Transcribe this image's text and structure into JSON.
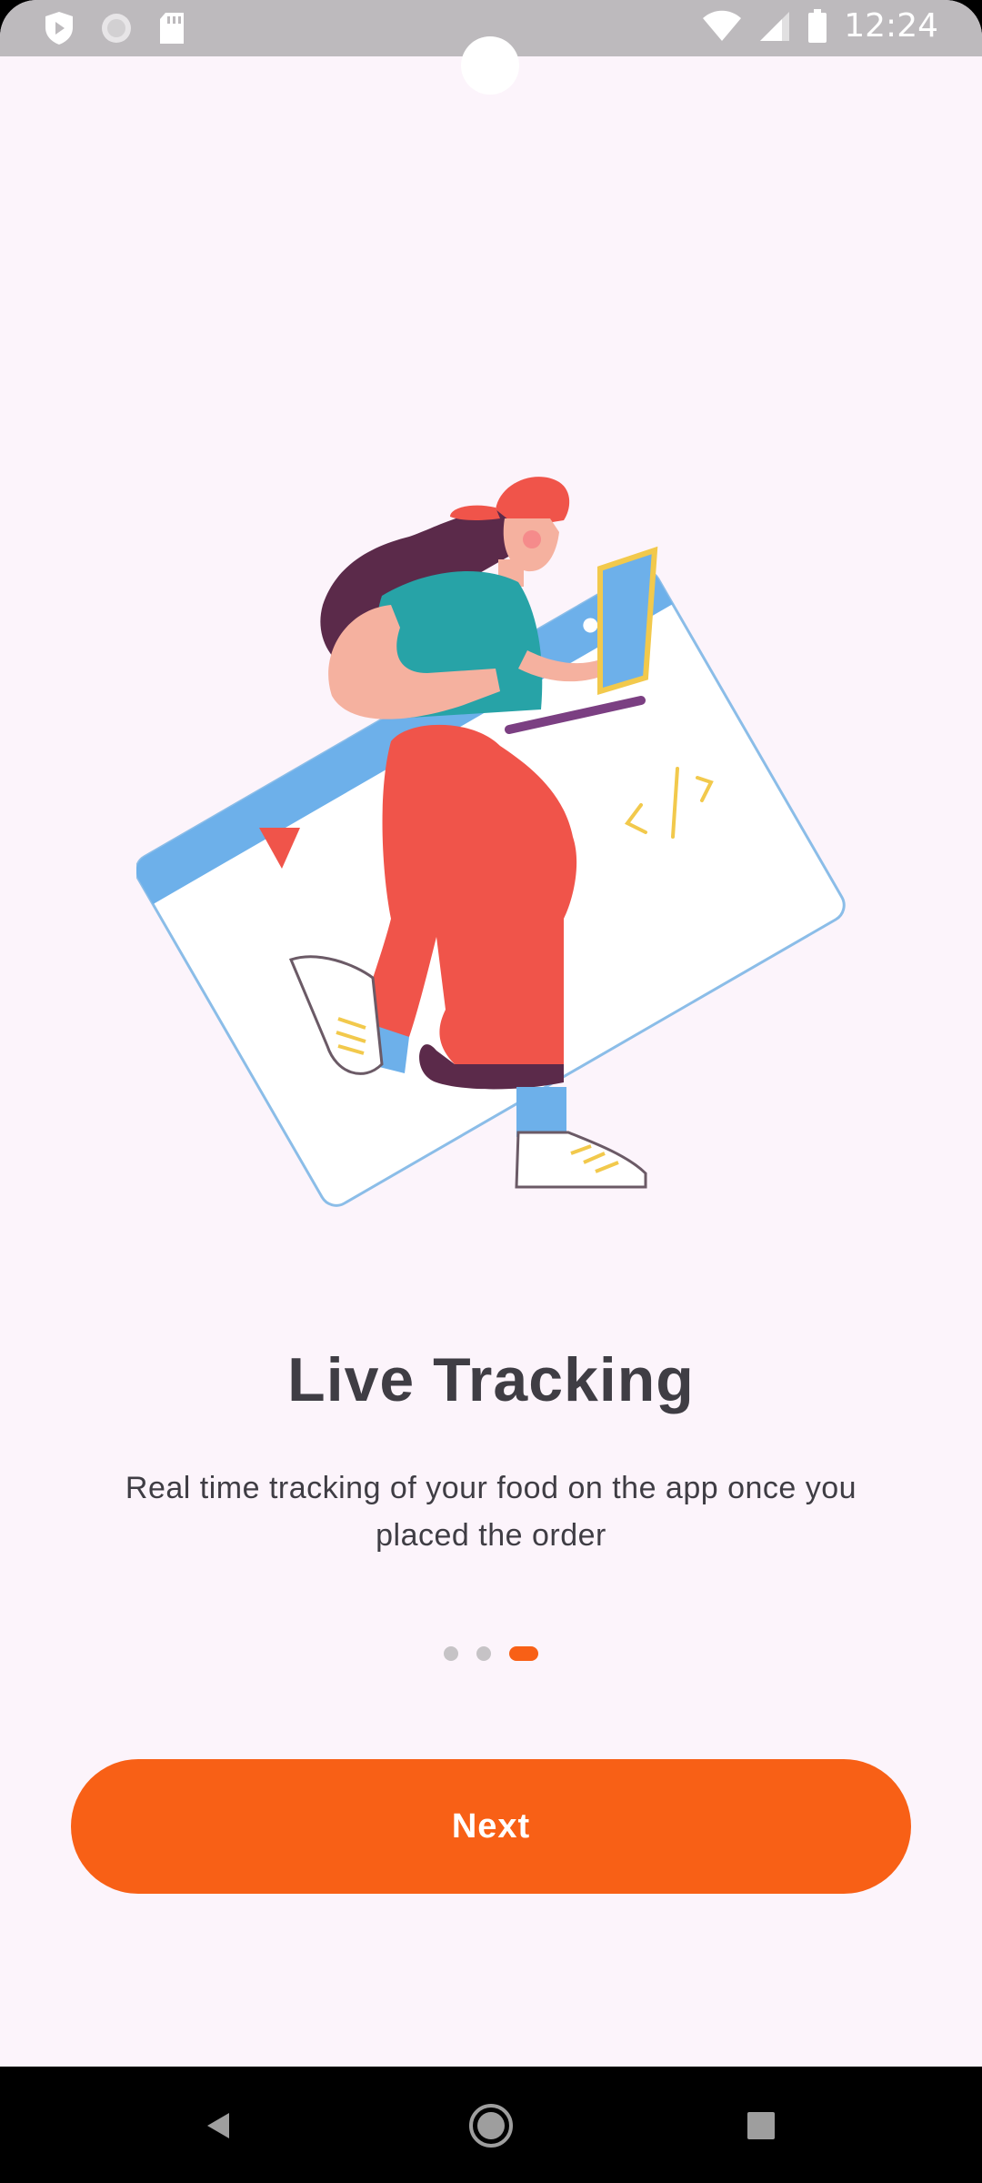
{
  "status_bar": {
    "time": "12:24",
    "icons": [
      "shield-play-icon",
      "circle-status-icon",
      "sd-card-icon",
      "wifi-icon",
      "signal-icon",
      "battery-icon"
    ]
  },
  "illustration": {
    "description_icon": "person-with-laptop-illustration"
  },
  "onboarding": {
    "title": "Live Tracking",
    "subtitle": "Real time tracking of your food on the app once you placed the order",
    "page_count": 3,
    "active_page": 3
  },
  "actions": {
    "next_label": "Next"
  },
  "nav_bar": {
    "icons": [
      "back-icon",
      "home-icon",
      "recents-icon"
    ]
  },
  "colors": {
    "accent": "#f86016",
    "background": "#fcf4fb",
    "text": "#3f3d44",
    "status_bar": "#bdbabd"
  }
}
